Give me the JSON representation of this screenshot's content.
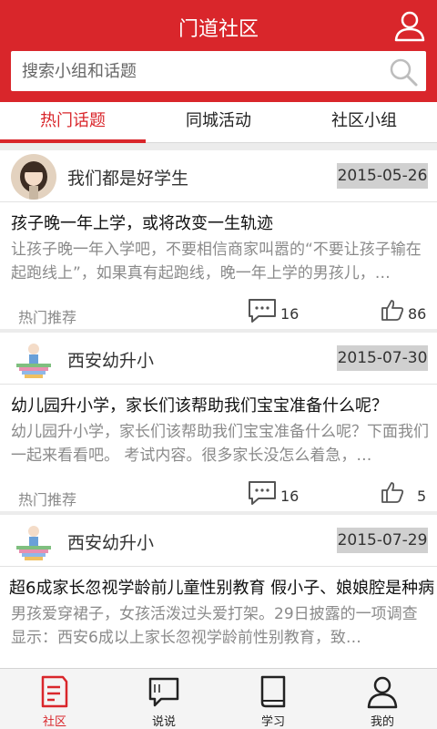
{
  "header": {
    "title": "门道社区"
  },
  "search": {
    "placeholder": "搜索小组和话题"
  },
  "tabs": [
    {
      "label": "热门话题",
      "active": true
    },
    {
      "label": "同城活动",
      "active": false
    },
    {
      "label": "社区小组",
      "active": false
    }
  ],
  "posts": [
    {
      "group": "我们都是好学生",
      "date": "2015-05-26",
      "title": "孩子晚一年上学，或将改变一生轨迹",
      "body": "让孩子晚一年入学吧，不要相信商家叫嚣的“不要让孩子输在起跑线上”，如果真有起跑线，晚一年上学的男孩儿，…",
      "tag": "热门推荐",
      "comments": "16",
      "likes": "86"
    },
    {
      "group": "西安幼升小",
      "date": "2015-07-30",
      "title": "幼儿园升小学，家长们该帮助我们宝宝准备什么呢？",
      "body": " 幼儿园升小学，家长们该帮助我们宝宝准备什么呢？下面我们一起来看看吧。 考试内容。很多家长没怎么着急，…",
      "tag": "热门推荐",
      "comments": "16",
      "likes": "5"
    },
    {
      "group": "西安幼升小",
      "date": "2015-07-29",
      "title": "超6成家长忽视学龄前儿童性别教育 假小子、娘娘腔是种病",
      "body": "      男孩爱穿裙子，女孩活泼过头爱打架。29日披露的一项调查显示：西安6成以上家长忽视学龄前性别教育，致…",
      "tag": "",
      "comments": "",
      "likes": ""
    }
  ],
  "bottom_nav": [
    {
      "label": "社区",
      "icon": "community-icon",
      "active": true
    },
    {
      "label": "说说",
      "icon": "chat-icon",
      "active": false
    },
    {
      "label": "学习",
      "icon": "book-icon",
      "active": false
    },
    {
      "label": "我的",
      "icon": "profile-icon",
      "active": false
    }
  ],
  "colors": {
    "accent": "#d9262b",
    "badge_bg": "#d0d0d0",
    "muted_text": "#8a8a8a"
  }
}
